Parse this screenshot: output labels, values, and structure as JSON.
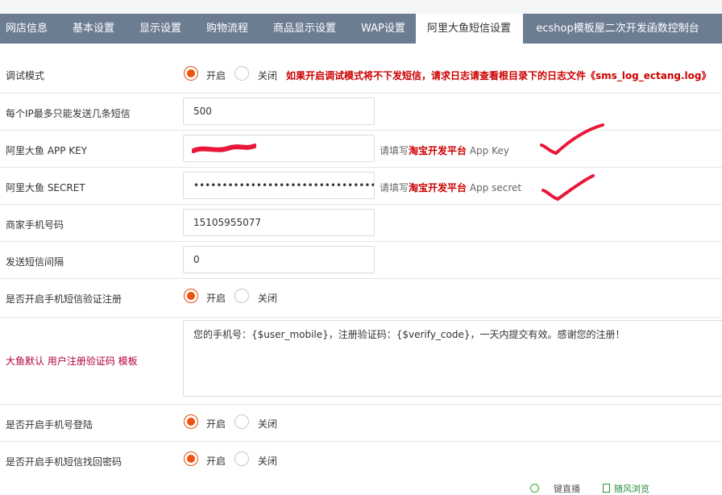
{
  "tabs": [
    "网店信息",
    "基本设置",
    "显示设置",
    "购物流程",
    "商品显示设置",
    "WAP设置",
    "阿里大鱼短信设置",
    "ecshop模板屋二次开发函数控制台"
  ],
  "active_tab": 6,
  "rows": {
    "debug": {
      "label": "调试模式",
      "on": "开启",
      "off": "关闭",
      "warning": "如果开启调试模式将不下发短信，请求日志请查看根目录下的日志文件《sms_log_ectang.log》"
    },
    "ip_limit": {
      "label": "每个IP最多只能发送几条短信",
      "value": "500"
    },
    "app_key": {
      "label": "阿里大鱼 APP KEY",
      "hint_prefix": "请填写",
      "hint_strong": "淘宝开发平台",
      "hint_suffix": " App Key"
    },
    "secret": {
      "label": "阿里大鱼 SECRET",
      "value": "••••••••••••••••••••••••••••••••",
      "hint_prefix": "请填写",
      "hint_strong": "淘宝开发平台",
      "hint_suffix": " App secret"
    },
    "phone": {
      "label": "商家手机号码",
      "value": "15105955077"
    },
    "interval": {
      "label": "发送短信间隔",
      "value": "0"
    },
    "reg_verify": {
      "label": "是否开启手机短信验证注册",
      "on": "开启",
      "off": "关闭"
    },
    "template": {
      "label": "大鱼默认 用户注册验证码 模板",
      "value": "您的手机号：{$user_mobile}，注册验证码：{$verify_code}，一天内提交有效。感谢您的注册！"
    },
    "phone_login": {
      "label": "是否开启手机号登陆",
      "on": "开启",
      "off": "关闭"
    },
    "find_pwd": {
      "label": "是否开启手机短信找回密码",
      "on": "开启",
      "off": "关闭"
    }
  },
  "bottom": [
    "键直播",
    "随风浏览"
  ],
  "colors": {
    "tab_bar": "#6c7d92",
    "radio_checked": "#f0510f",
    "warn": "#cc0000",
    "checkmark": "#e8173a"
  }
}
